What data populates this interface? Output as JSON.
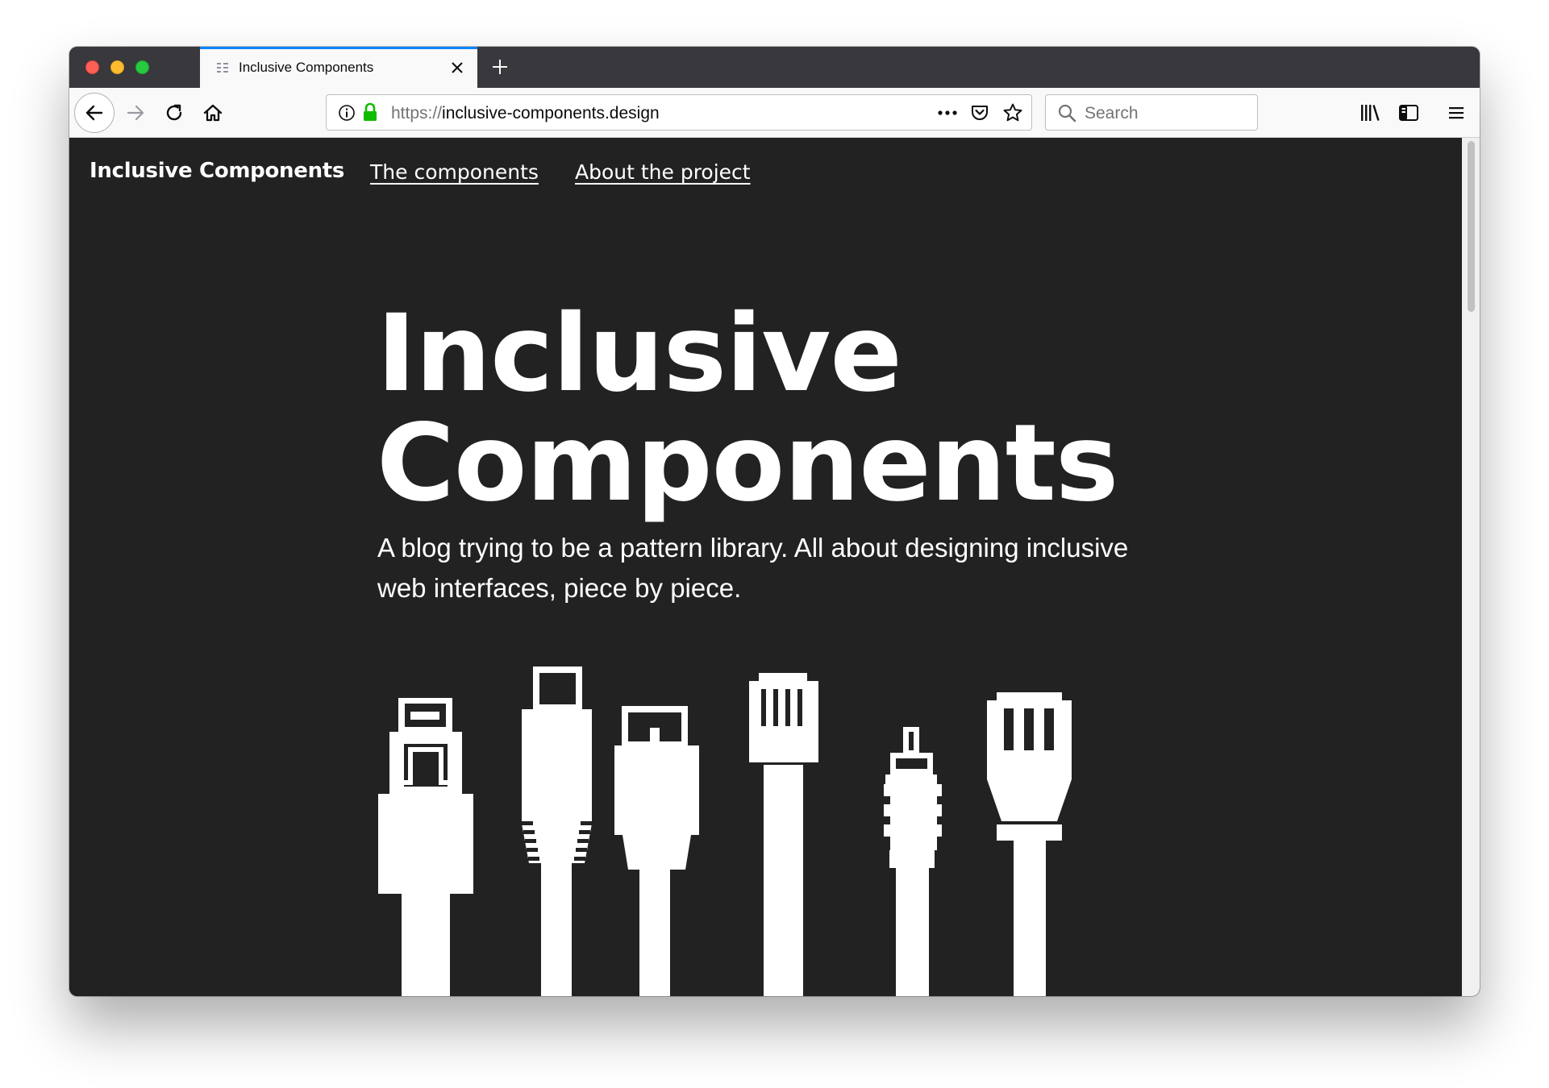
{
  "browser": {
    "tab": {
      "title": "Inclusive Components"
    },
    "url": {
      "scheme": "https://",
      "host": "inclusive-components.design"
    },
    "search": {
      "placeholder": "Search"
    }
  },
  "site": {
    "brand": "Inclusive Components",
    "nav": [
      {
        "label": "The components"
      },
      {
        "label": "About the project"
      }
    ],
    "hero": {
      "title_line1": "Inclusive",
      "title_line2": "Components",
      "description": "A blog trying to be a pattern library. All about designing inclusive web interfaces, piece by piece."
    }
  },
  "colors": {
    "page_background": "#222222",
    "text": "#ffffff",
    "tab_accent": "#0a84ff",
    "lock_green": "#12bc00"
  }
}
